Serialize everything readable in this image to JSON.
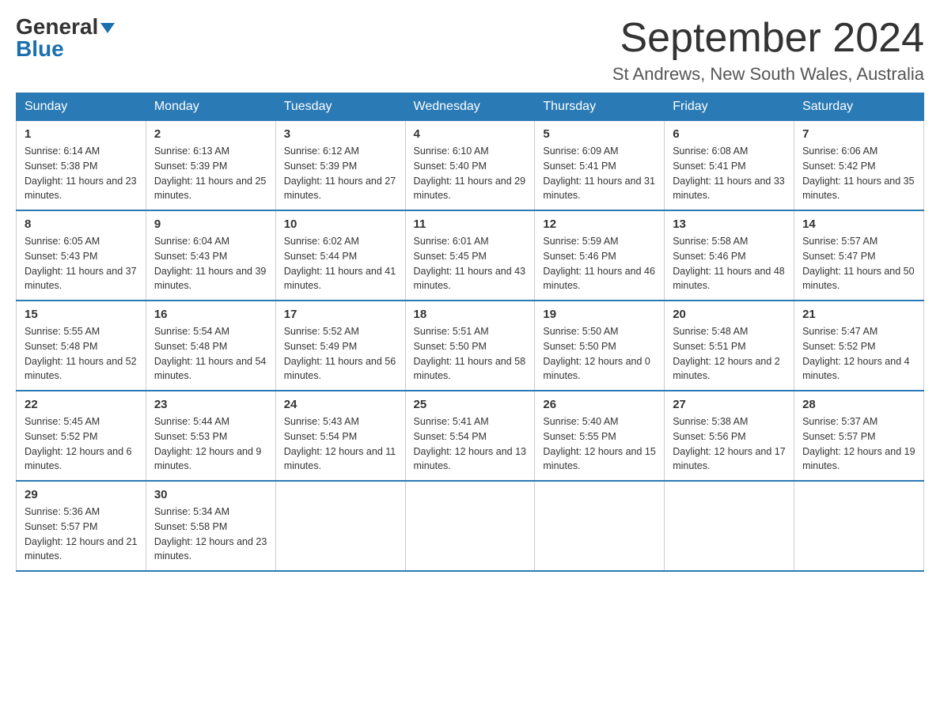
{
  "header": {
    "logo_line1": "General",
    "logo_line2": "Blue",
    "month_title": "September 2024",
    "location": "St Andrews, New South Wales, Australia"
  },
  "days_of_week": [
    "Sunday",
    "Monday",
    "Tuesday",
    "Wednesday",
    "Thursday",
    "Friday",
    "Saturday"
  ],
  "weeks": [
    [
      {
        "date": "1",
        "sunrise": "6:14 AM",
        "sunset": "5:38 PM",
        "daylight": "11 hours and 23 minutes."
      },
      {
        "date": "2",
        "sunrise": "6:13 AM",
        "sunset": "5:39 PM",
        "daylight": "11 hours and 25 minutes."
      },
      {
        "date": "3",
        "sunrise": "6:12 AM",
        "sunset": "5:39 PM",
        "daylight": "11 hours and 27 minutes."
      },
      {
        "date": "4",
        "sunrise": "6:10 AM",
        "sunset": "5:40 PM",
        "daylight": "11 hours and 29 minutes."
      },
      {
        "date": "5",
        "sunrise": "6:09 AM",
        "sunset": "5:41 PM",
        "daylight": "11 hours and 31 minutes."
      },
      {
        "date": "6",
        "sunrise": "6:08 AM",
        "sunset": "5:41 PM",
        "daylight": "11 hours and 33 minutes."
      },
      {
        "date": "7",
        "sunrise": "6:06 AM",
        "sunset": "5:42 PM",
        "daylight": "11 hours and 35 minutes."
      }
    ],
    [
      {
        "date": "8",
        "sunrise": "6:05 AM",
        "sunset": "5:43 PM",
        "daylight": "11 hours and 37 minutes."
      },
      {
        "date": "9",
        "sunrise": "6:04 AM",
        "sunset": "5:43 PM",
        "daylight": "11 hours and 39 minutes."
      },
      {
        "date": "10",
        "sunrise": "6:02 AM",
        "sunset": "5:44 PM",
        "daylight": "11 hours and 41 minutes."
      },
      {
        "date": "11",
        "sunrise": "6:01 AM",
        "sunset": "5:45 PM",
        "daylight": "11 hours and 43 minutes."
      },
      {
        "date": "12",
        "sunrise": "5:59 AM",
        "sunset": "5:46 PM",
        "daylight": "11 hours and 46 minutes."
      },
      {
        "date": "13",
        "sunrise": "5:58 AM",
        "sunset": "5:46 PM",
        "daylight": "11 hours and 48 minutes."
      },
      {
        "date": "14",
        "sunrise": "5:57 AM",
        "sunset": "5:47 PM",
        "daylight": "11 hours and 50 minutes."
      }
    ],
    [
      {
        "date": "15",
        "sunrise": "5:55 AM",
        "sunset": "5:48 PM",
        "daylight": "11 hours and 52 minutes."
      },
      {
        "date": "16",
        "sunrise": "5:54 AM",
        "sunset": "5:48 PM",
        "daylight": "11 hours and 54 minutes."
      },
      {
        "date": "17",
        "sunrise": "5:52 AM",
        "sunset": "5:49 PM",
        "daylight": "11 hours and 56 minutes."
      },
      {
        "date": "18",
        "sunrise": "5:51 AM",
        "sunset": "5:50 PM",
        "daylight": "11 hours and 58 minutes."
      },
      {
        "date": "19",
        "sunrise": "5:50 AM",
        "sunset": "5:50 PM",
        "daylight": "12 hours and 0 minutes."
      },
      {
        "date": "20",
        "sunrise": "5:48 AM",
        "sunset": "5:51 PM",
        "daylight": "12 hours and 2 minutes."
      },
      {
        "date": "21",
        "sunrise": "5:47 AM",
        "sunset": "5:52 PM",
        "daylight": "12 hours and 4 minutes."
      }
    ],
    [
      {
        "date": "22",
        "sunrise": "5:45 AM",
        "sunset": "5:52 PM",
        "daylight": "12 hours and 6 minutes."
      },
      {
        "date": "23",
        "sunrise": "5:44 AM",
        "sunset": "5:53 PM",
        "daylight": "12 hours and 9 minutes."
      },
      {
        "date": "24",
        "sunrise": "5:43 AM",
        "sunset": "5:54 PM",
        "daylight": "12 hours and 11 minutes."
      },
      {
        "date": "25",
        "sunrise": "5:41 AM",
        "sunset": "5:54 PM",
        "daylight": "12 hours and 13 minutes."
      },
      {
        "date": "26",
        "sunrise": "5:40 AM",
        "sunset": "5:55 PM",
        "daylight": "12 hours and 15 minutes."
      },
      {
        "date": "27",
        "sunrise": "5:38 AM",
        "sunset": "5:56 PM",
        "daylight": "12 hours and 17 minutes."
      },
      {
        "date": "28",
        "sunrise": "5:37 AM",
        "sunset": "5:57 PM",
        "daylight": "12 hours and 19 minutes."
      }
    ],
    [
      {
        "date": "29",
        "sunrise": "5:36 AM",
        "sunset": "5:57 PM",
        "daylight": "12 hours and 21 minutes."
      },
      {
        "date": "30",
        "sunrise": "5:34 AM",
        "sunset": "5:58 PM",
        "daylight": "12 hours and 23 minutes."
      },
      null,
      null,
      null,
      null,
      null
    ]
  ]
}
